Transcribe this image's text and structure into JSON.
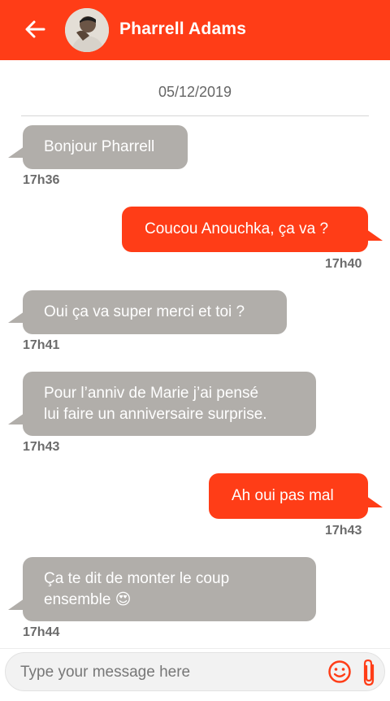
{
  "header": {
    "contact_name": "Pharrell Adams",
    "back_icon": "arrow-left-icon",
    "avatar_icon": "avatar"
  },
  "conversation": {
    "date": "05/12/2019",
    "messages": [
      {
        "direction": "incoming",
        "text": "Bonjour Pharrell",
        "time": "17h36"
      },
      {
        "direction": "outgoing",
        "text": "Coucou Anouchka, ça va ?",
        "time": "17h40"
      },
      {
        "direction": "incoming",
        "text": "Oui ça va super merci et toi ?",
        "time": "17h41"
      },
      {
        "direction": "incoming",
        "text_line1": "Pour l’anniv de Marie j’ai pensé",
        "text_line2": "lui faire un anniversaire surprise.",
        "time": "17h43"
      },
      {
        "direction": "outgoing",
        "text": "Ah oui pas mal",
        "time": "17h43"
      },
      {
        "direction": "incoming",
        "text_line1": "Ça te dit de monter le coup",
        "text_line2": "ensemble",
        "emoji": "😍",
        "time": "17h44"
      }
    ]
  },
  "composer": {
    "placeholder": "Type your message here",
    "emoji_icon": "smiley-icon",
    "attach_icon": "paperclip-icon"
  },
  "colors": {
    "accent": "#ff3d17",
    "incoming_bubble": "#b1aeaa"
  }
}
